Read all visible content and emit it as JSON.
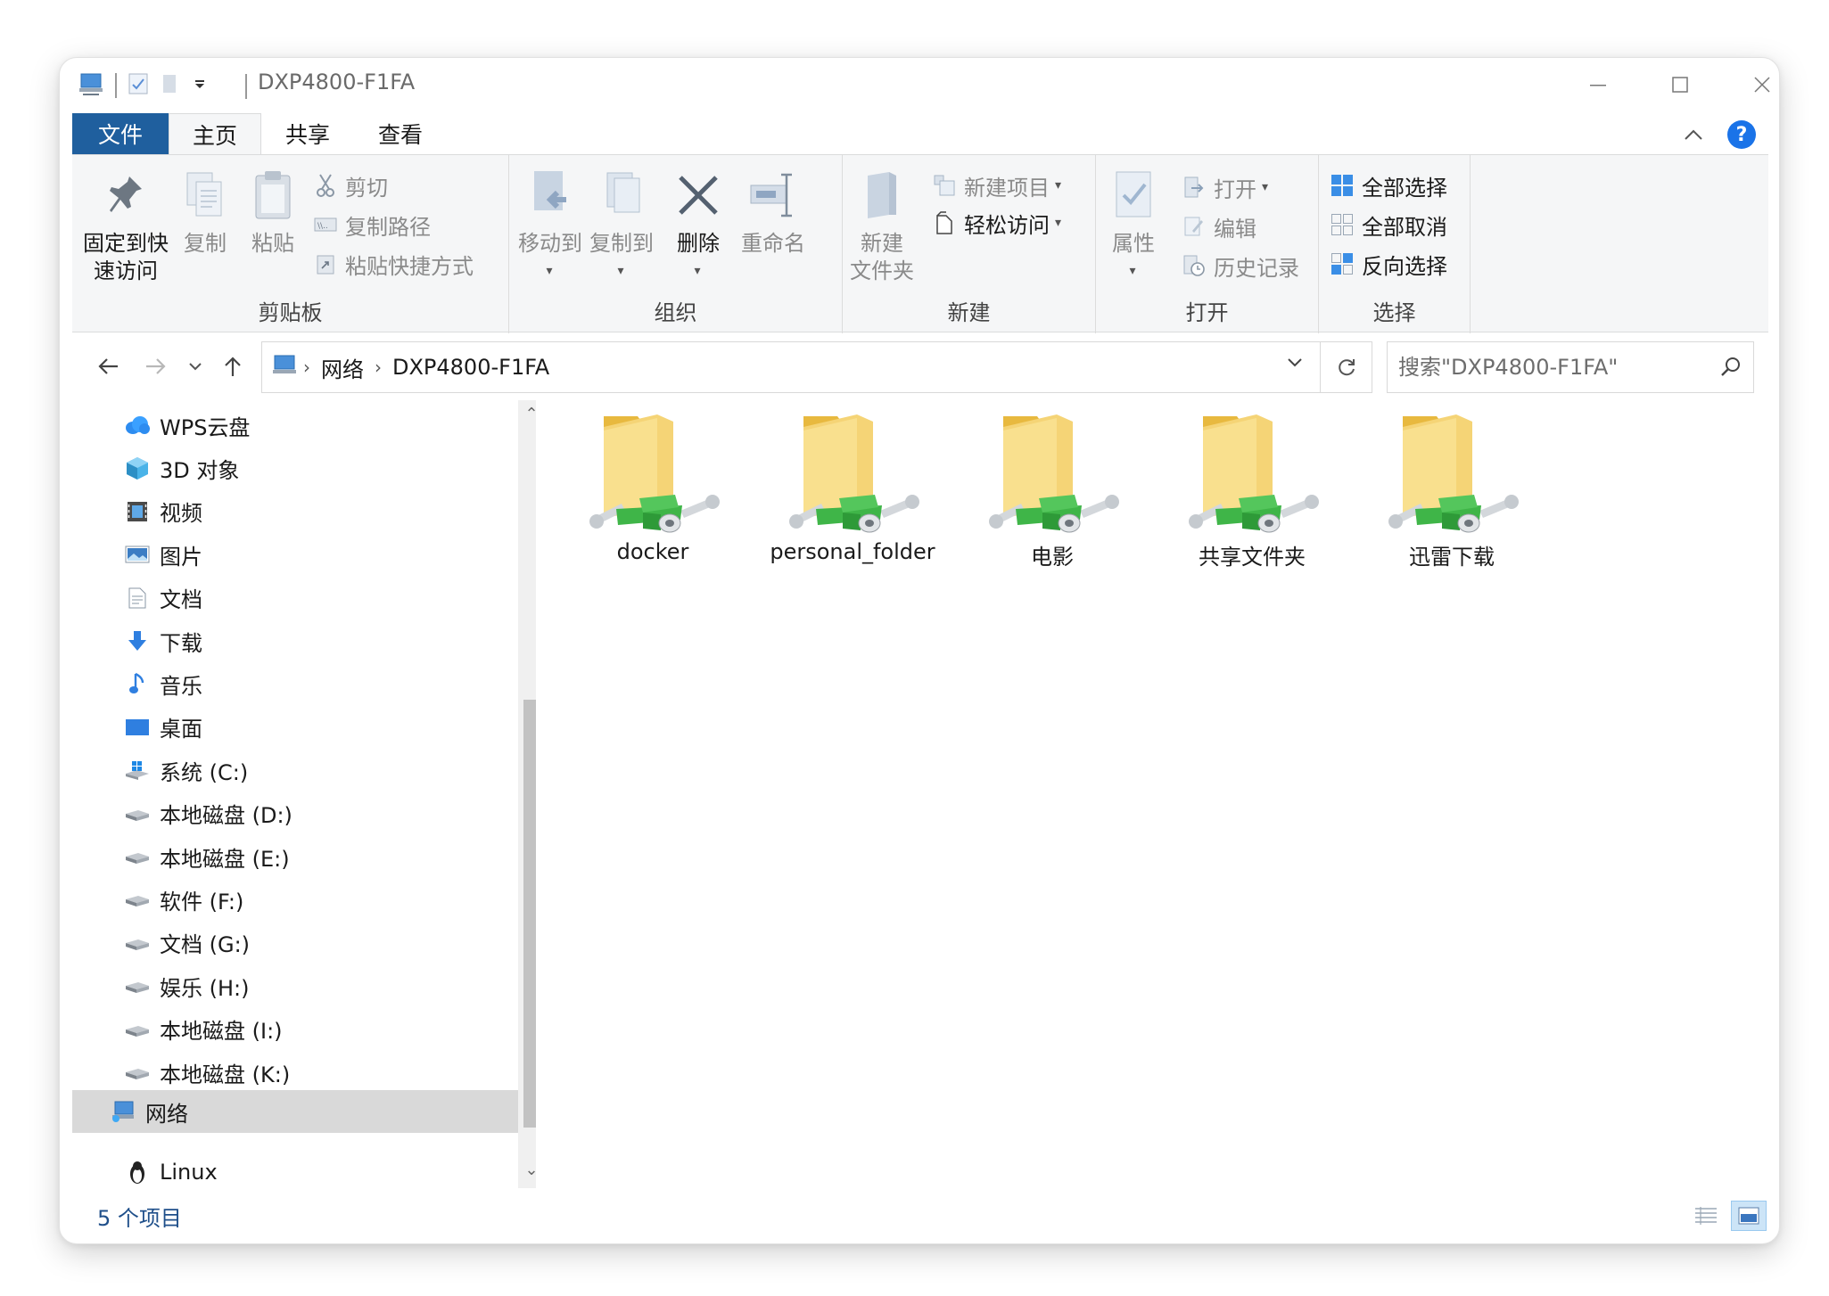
{
  "window": {
    "title": "DXP4800-F1FA"
  },
  "ribbon_tabs": {
    "file": "文件",
    "home": "主页",
    "share": "共享",
    "view": "查看"
  },
  "ribbon": {
    "clipboard": {
      "label": "剪贴板",
      "pin": "固定到快\n速访问",
      "pin_line1": "固定到快",
      "pin_line2": "速访问",
      "copy": "复制",
      "paste": "粘贴",
      "cut": "剪切",
      "copy_path": "复制路径",
      "paste_shortcut": "粘贴快捷方式"
    },
    "organize": {
      "label": "组织",
      "move_to": "移动到",
      "copy_to": "复制到",
      "delete": "删除",
      "rename": "重命名"
    },
    "new": {
      "label": "新建",
      "new_folder_line1": "新建",
      "new_folder_line2": "文件夹",
      "new_item": "新建项目",
      "easy_access": "轻松访问"
    },
    "open": {
      "label": "打开",
      "properties": "属性",
      "open": "打开",
      "edit": "编辑",
      "history": "历史记录"
    },
    "select": {
      "label": "选择",
      "select_all": "全部选择",
      "select_none": "全部取消",
      "invert": "反向选择"
    }
  },
  "address": {
    "crumbs": [
      "网络",
      "DXP4800-F1FA"
    ],
    "search_placeholder": "搜索\"DXP4800-F1FA\""
  },
  "nav_pane": {
    "items": [
      {
        "label": "WPS云盘",
        "icon": "cloud-icon"
      },
      {
        "label": "3D 对象",
        "icon": "cube-icon"
      },
      {
        "label": "视频",
        "icon": "film-icon"
      },
      {
        "label": "图片",
        "icon": "picture-icon"
      },
      {
        "label": "文档",
        "icon": "document-icon"
      },
      {
        "label": "下载",
        "icon": "download-arrow-icon"
      },
      {
        "label": "音乐",
        "icon": "music-note-icon"
      },
      {
        "label": "桌面",
        "icon": "desktop-icon"
      },
      {
        "label": "系统 (C:)",
        "icon": "windows-drive-icon"
      },
      {
        "label": "本地磁盘 (D:)",
        "icon": "drive-icon"
      },
      {
        "label": "本地磁盘 (E:)",
        "icon": "drive-icon"
      },
      {
        "label": "软件 (F:)",
        "icon": "drive-icon"
      },
      {
        "label": "文档 (G:)",
        "icon": "drive-icon"
      },
      {
        "label": "娱乐 (H:)",
        "icon": "drive-icon"
      },
      {
        "label": "本地磁盘 (I:)",
        "icon": "drive-icon"
      },
      {
        "label": "本地磁盘 (K:)",
        "icon": "drive-icon"
      }
    ],
    "network": "网络",
    "linux": "Linux"
  },
  "content": {
    "folders": [
      "docker",
      "personal_folder",
      "电影",
      "共享文件夹",
      "迅雷下载"
    ]
  },
  "status": {
    "count": "5 个项目"
  },
  "colors": {
    "file_tab": "#1f5f9e",
    "accent_blue": "#1a73e8",
    "folder_yellow": "#f7d774",
    "share_green": "#3fb548"
  }
}
